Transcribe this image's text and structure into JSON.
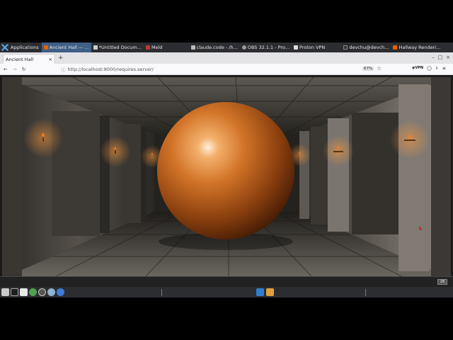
{
  "system_panel": {
    "applications_label": "Applications",
    "tasks": [
      {
        "label": "Ancient Hall — ...",
        "color": "#e66000",
        "active": true
      },
      {
        "label": "*Untitled Docum...",
        "color": "#cccccc",
        "active": false
      },
      {
        "label": "Meld",
        "color": "#c0392b",
        "active": false
      },
      {
        "label": "claude.code - /h...",
        "color": "#bbbbbb",
        "active": false
      },
      {
        "label": "OBS 32.1.1 - Pro...",
        "color": "#999999",
        "active": false
      },
      {
        "label": "Proton VPN",
        "color": "#dddddd",
        "active": false
      },
      {
        "label": "devchu@devch...",
        "color": "#333333",
        "active": false
      },
      {
        "label": "Hallway Renderi...",
        "color": "#e66000",
        "active": false
      }
    ]
  },
  "browser": {
    "tab_title": "Ancient Hall",
    "tab_close": "×",
    "new_tab": "+",
    "url": "http://localhost:8000/requires.server/",
    "zoom": "67%",
    "vpn_label": "VPN",
    "window_controls": [
      "–",
      "□",
      "×"
    ]
  },
  "page": {
    "status_badge": "28"
  },
  "colors": {
    "panel_bg": "#2b2d31",
    "sphere_main": "#c8641e",
    "sphere_highlight": "#ffe6c8",
    "wall_dark": "#3a3733",
    "wall_light": "#8a857e",
    "torch_flame": "#ff7a1a"
  }
}
